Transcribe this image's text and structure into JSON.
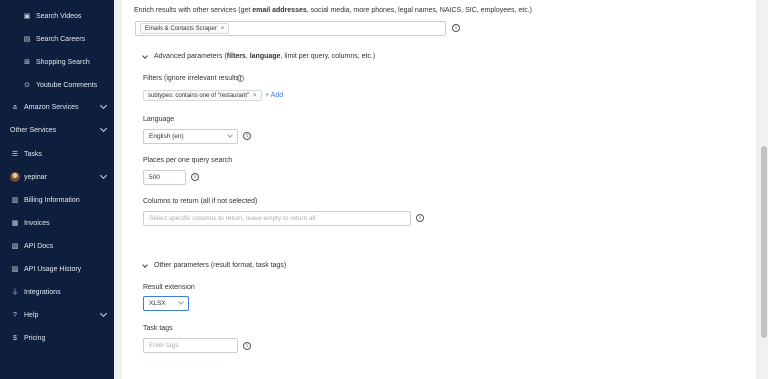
{
  "sidebar": {
    "items": [
      {
        "label": "Search Videos",
        "icon": "video-icon"
      },
      {
        "label": "Search Careers",
        "icon": "briefcase-icon"
      },
      {
        "label": "Shopping Search",
        "icon": "shopping-cart-icon"
      },
      {
        "label": "Youtube Comments",
        "icon": "play-icon"
      },
      {
        "label": "Amazon Services",
        "icon": "amazon-icon"
      },
      {
        "label": "Other Services"
      },
      {
        "label": "Tasks",
        "icon": "list-icon"
      },
      {
        "label": "yepinar",
        "icon": "avatar"
      },
      {
        "label": "Billing Information",
        "icon": "document-icon"
      },
      {
        "label": "Invoices",
        "icon": "invoice-icon"
      },
      {
        "label": "API Docs",
        "icon": "api-docs-icon"
      },
      {
        "label": "API Usage History",
        "icon": "history-icon"
      },
      {
        "label": "Integrations",
        "icon": "plug-icon"
      },
      {
        "label": "Help",
        "icon": "help-icon"
      },
      {
        "label": "Pricing",
        "icon": "dollar-icon"
      }
    ]
  },
  "enrich": {
    "label_prefix": "Enrich results with other services (get ",
    "label_bold": "email addresses",
    "label_suffix": ", social media, more phones, legal names, NAICS, SIC, employees, etc.)",
    "tag": "Emails & Contacts Scraper"
  },
  "advanced": {
    "prefix": "Advanced parameters (",
    "bold1": "filters",
    "sep": ", ",
    "bold2": "language",
    "suffix": ", limit per query, columns, etc.)"
  },
  "filters": {
    "label": "Filters (ignore irrelevant results)",
    "tag": "subtypes: contains one of \"restaurant\"",
    "add": "+ Add"
  },
  "language": {
    "label": "Language",
    "value": "English (en)"
  },
  "places": {
    "label": "Places per one query search",
    "value": "500"
  },
  "columns": {
    "label": "Columns to return (all if not selected)",
    "placeholder": "Select specific columns to return, leave empty to return all"
  },
  "other": {
    "label": "Other parameters (result format, task tags)"
  },
  "extension": {
    "label": "Result extension",
    "value": "XLSX"
  },
  "task_tags": {
    "label": "Task tags",
    "placeholder": "Enter tags"
  },
  "colors": {
    "sidebar_bg": "#0d1f3c",
    "accent": "#3b7fd6",
    "focus_border": "#3b7fd6"
  }
}
